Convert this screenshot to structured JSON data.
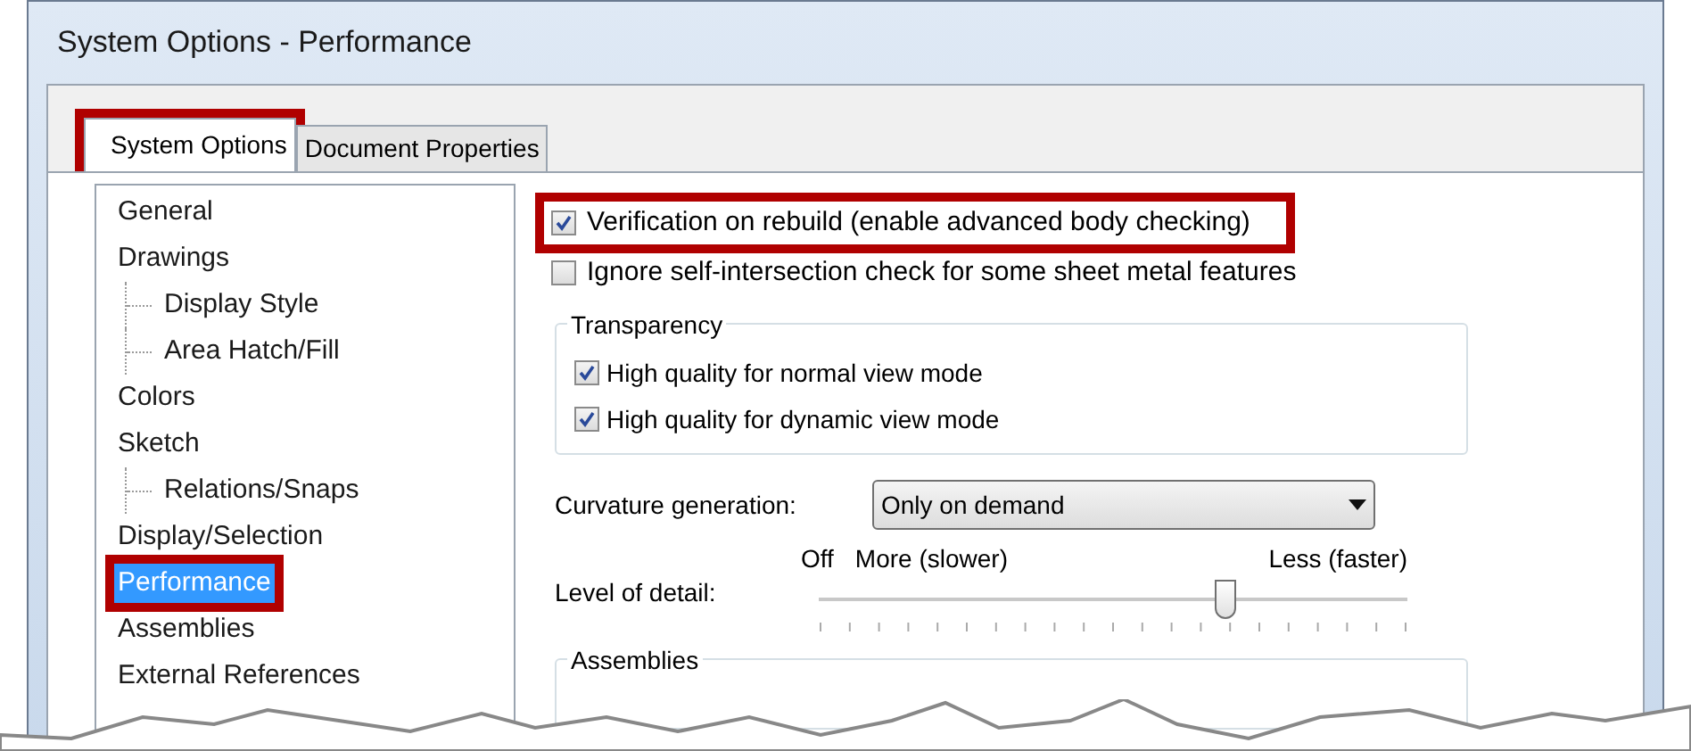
{
  "window": {
    "title": "System Options - Performance"
  },
  "tabs": [
    {
      "label": "System Options",
      "selected": true,
      "highlighted": true
    },
    {
      "label": "Document Properties",
      "selected": false,
      "highlighted": false
    }
  ],
  "tree": [
    {
      "label": "General",
      "selected": false,
      "highlighted": false
    },
    {
      "label": "Drawings",
      "selected": false,
      "highlighted": false,
      "children": [
        {
          "label": "Display Style",
          "selected": false,
          "highlighted": false
        },
        {
          "label": "Area Hatch/Fill",
          "selected": false,
          "highlighted": false
        }
      ]
    },
    {
      "label": "Colors",
      "selected": false,
      "highlighted": false
    },
    {
      "label": "Sketch",
      "selected": false,
      "highlighted": false,
      "children": [
        {
          "label": "Relations/Snaps",
          "selected": false,
          "highlighted": false
        }
      ]
    },
    {
      "label": "Display/Selection",
      "selected": false,
      "highlighted": false
    },
    {
      "label": "Performance",
      "selected": true,
      "highlighted": true
    },
    {
      "label": "Assemblies",
      "selected": false,
      "highlighted": false
    },
    {
      "label": "External References",
      "selected": false,
      "highlighted": false
    }
  ],
  "options": [
    {
      "label": "Verification on rebuild (enable advanced body checking)",
      "checked": true,
      "highlighted": true
    },
    {
      "label": "Ignore self-intersection check for some sheet metal features",
      "checked": false,
      "highlighted": false
    }
  ],
  "transparency": {
    "title": "Transparency",
    "options": [
      {
        "label": "High quality for normal view mode",
        "checked": true
      },
      {
        "label": "High quality for dynamic view mode",
        "checked": true
      }
    ]
  },
  "curvature": {
    "label": "Curvature generation:",
    "value": "Only on demand"
  },
  "level_of_detail": {
    "label": "Level of detail:",
    "off_label": "Off",
    "more_label": "More (slower)",
    "less_label": "Less (faster)",
    "level": 0.69
  },
  "assemblies": {
    "title": "Assemblies"
  }
}
